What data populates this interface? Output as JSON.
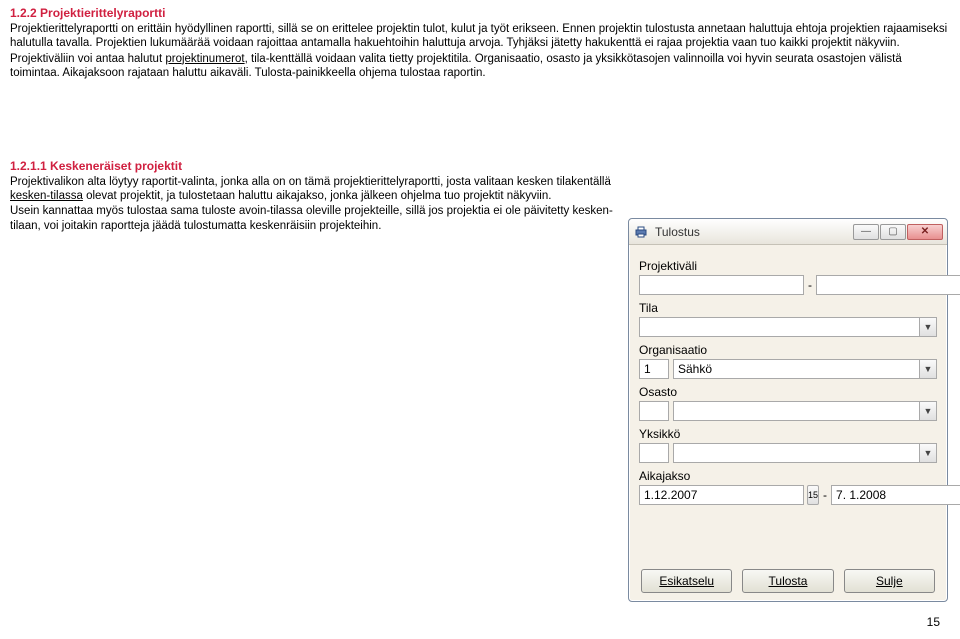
{
  "section": {
    "number": "1.2.2",
    "title": "Projektierittelyraportti",
    "p1": "Projektierittelyraportti on erittäin hyödyllinen raportti, sillä se on erittelee projektin tulot, kulut ja työt erikseen. Ennen projektin tulostusta annetaan haluttuja ehtoja projektien rajaamiseksi halutulla tavalla. Projektien lukumäärää voidaan rajoittaa antamalla hakuehtoihin haluttuja arvoja. Tyhjäksi jätetty hakukenttä ei rajaa projektia vaan tuo kaikki projektit näkyviin.",
    "p2a": "Projektiväliin voi antaa halutut ",
    "p2b": "projektinumerot",
    "p2c": ", tila-kenttällä voidaan valita tietty projektitila. Organisaatio, osasto ja yksikkötasojen valinnoilla voi hyvin seurata osastojen välistä toimintaa. Aikajaksoon rajataan haluttu aikaväli. Tulosta-painikkeella ohjema tulostaa raportin."
  },
  "subsection": {
    "number": "1.2.1.1",
    "title": "Keskeneräiset projektit",
    "p1a": "Projektivalikon alta löytyy raportit-valinta, jonka alla on on tämä projektierittelyraportti, josta valitaan kesken tilakentällä ",
    "p1b": "kesken-tilassa",
    "p1c": " olevat projektit, ja tulostetaan haluttu aikajakso, jonka jälkeen ohjelma tuo projektit näkyviin.",
    "p2": "Usein kannattaa myös tulostaa sama tuloste avoin-tilassa oleville projekteille, sillä jos projektia ei ole päivitetty kesken-tilaan, voi joitakin raportteja jäädä tulostumatta keskenräisiin projekteihin."
  },
  "dialog": {
    "title": "Tulostus",
    "labels": {
      "projektivali": "Projektiväli",
      "tila": "Tila",
      "organisaatio": "Organisaatio",
      "osasto": "Osasto",
      "yksikko": "Yksikkö",
      "aikajakso": "Aikajakso"
    },
    "values": {
      "org_num": "1",
      "org_name": "Sähkö",
      "date_from": "1.12.2007",
      "date_to": "7. 1.2008"
    },
    "buttons": {
      "esikatselu": "Esikatselu",
      "tulosta": "Tulosta",
      "sulje": "Sulje"
    }
  },
  "page_number": "15"
}
